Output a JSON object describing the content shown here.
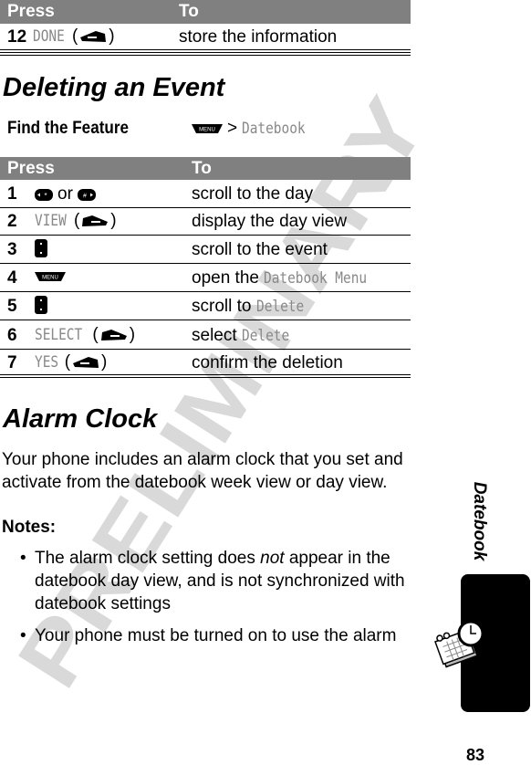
{
  "watermark": "PRELIMINARY",
  "table1": {
    "header": {
      "press": "Press",
      "to": "To"
    },
    "rows": [
      {
        "num": "12",
        "key": "DONE",
        "icon": "left-soft-key-icon",
        "to": "store the information"
      }
    ]
  },
  "section1": {
    "title": "Deleting an Event",
    "find_feature": {
      "label": "Find the Feature",
      "icon": "menu-key-icon",
      "separator": ">",
      "path": "Datebook"
    }
  },
  "table2": {
    "header": {
      "press": "Press",
      "to": "To"
    },
    "rows": [
      {
        "num": "1",
        "or": "or",
        "to": "scroll to the day"
      },
      {
        "num": "2",
        "key": "VIEW",
        "to": "display the day view"
      },
      {
        "num": "3",
        "to": "scroll to the event"
      },
      {
        "num": "4",
        "to": "open the",
        "to_mono": "Datebook Menu"
      },
      {
        "num": "5",
        "to": "scroll to",
        "to_mono": "Delete"
      },
      {
        "num": "6",
        "key": "SELECT",
        "to": "select",
        "to_mono": "Delete"
      },
      {
        "num": "7",
        "key": "YES",
        "to": "confirm the deletion"
      }
    ]
  },
  "section2": {
    "title": "Alarm Clock",
    "intro_lines": [
      "Your phone includes an alarm clock that you set and",
      "activate from the datebook week view or day view."
    ],
    "notes_label": "Notes:",
    "notes": [
      {
        "pre": "The alarm clock setting does ",
        "em": "not",
        "post": " appear in the",
        "line2": "datebook day view, and is not synchronized with",
        "line3": "datebook settings"
      },
      {
        "pre": "Your phone must be turned on to use the alarm"
      }
    ]
  },
  "side": {
    "chapter": "Datebook",
    "tab_color": "#000000",
    "icon": "datebook-alarm-clock-icon"
  },
  "page_number": "83",
  "colors": {
    "header_bg": "#808080",
    "mono_text": "#888888",
    "watermark": "#d9d9d9"
  }
}
